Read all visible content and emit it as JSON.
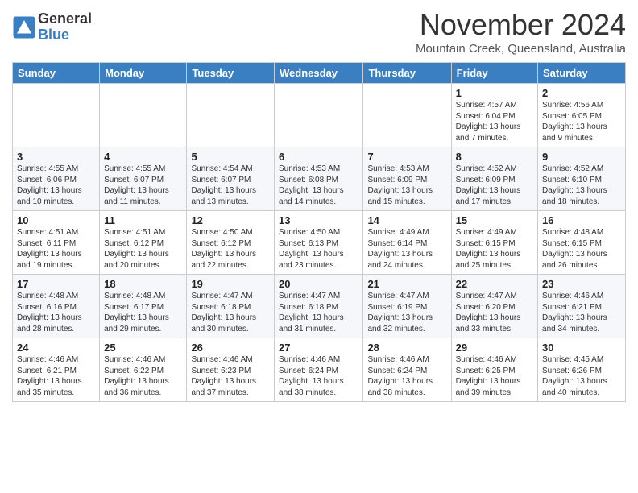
{
  "logo": {
    "general": "General",
    "blue": "Blue"
  },
  "header": {
    "month": "November 2024",
    "location": "Mountain Creek, Queensland, Australia"
  },
  "days_header": [
    "Sunday",
    "Monday",
    "Tuesday",
    "Wednesday",
    "Thursday",
    "Friday",
    "Saturday"
  ],
  "weeks": [
    [
      {
        "day": "",
        "info": ""
      },
      {
        "day": "",
        "info": ""
      },
      {
        "day": "",
        "info": ""
      },
      {
        "day": "",
        "info": ""
      },
      {
        "day": "",
        "info": ""
      },
      {
        "day": "1",
        "info": "Sunrise: 4:57 AM\nSunset: 6:04 PM\nDaylight: 13 hours and 7 minutes."
      },
      {
        "day": "2",
        "info": "Sunrise: 4:56 AM\nSunset: 6:05 PM\nDaylight: 13 hours and 9 minutes."
      }
    ],
    [
      {
        "day": "3",
        "info": "Sunrise: 4:55 AM\nSunset: 6:06 PM\nDaylight: 13 hours and 10 minutes."
      },
      {
        "day": "4",
        "info": "Sunrise: 4:55 AM\nSunset: 6:07 PM\nDaylight: 13 hours and 11 minutes."
      },
      {
        "day": "5",
        "info": "Sunrise: 4:54 AM\nSunset: 6:07 PM\nDaylight: 13 hours and 13 minutes."
      },
      {
        "day": "6",
        "info": "Sunrise: 4:53 AM\nSunset: 6:08 PM\nDaylight: 13 hours and 14 minutes."
      },
      {
        "day": "7",
        "info": "Sunrise: 4:53 AM\nSunset: 6:09 PM\nDaylight: 13 hours and 15 minutes."
      },
      {
        "day": "8",
        "info": "Sunrise: 4:52 AM\nSunset: 6:09 PM\nDaylight: 13 hours and 17 minutes."
      },
      {
        "day": "9",
        "info": "Sunrise: 4:52 AM\nSunset: 6:10 PM\nDaylight: 13 hours and 18 minutes."
      }
    ],
    [
      {
        "day": "10",
        "info": "Sunrise: 4:51 AM\nSunset: 6:11 PM\nDaylight: 13 hours and 19 minutes."
      },
      {
        "day": "11",
        "info": "Sunrise: 4:51 AM\nSunset: 6:12 PM\nDaylight: 13 hours and 20 minutes."
      },
      {
        "day": "12",
        "info": "Sunrise: 4:50 AM\nSunset: 6:12 PM\nDaylight: 13 hours and 22 minutes."
      },
      {
        "day": "13",
        "info": "Sunrise: 4:50 AM\nSunset: 6:13 PM\nDaylight: 13 hours and 23 minutes."
      },
      {
        "day": "14",
        "info": "Sunrise: 4:49 AM\nSunset: 6:14 PM\nDaylight: 13 hours and 24 minutes."
      },
      {
        "day": "15",
        "info": "Sunrise: 4:49 AM\nSunset: 6:15 PM\nDaylight: 13 hours and 25 minutes."
      },
      {
        "day": "16",
        "info": "Sunrise: 4:48 AM\nSunset: 6:15 PM\nDaylight: 13 hours and 26 minutes."
      }
    ],
    [
      {
        "day": "17",
        "info": "Sunrise: 4:48 AM\nSunset: 6:16 PM\nDaylight: 13 hours and 28 minutes."
      },
      {
        "day": "18",
        "info": "Sunrise: 4:48 AM\nSunset: 6:17 PM\nDaylight: 13 hours and 29 minutes."
      },
      {
        "day": "19",
        "info": "Sunrise: 4:47 AM\nSunset: 6:18 PM\nDaylight: 13 hours and 30 minutes."
      },
      {
        "day": "20",
        "info": "Sunrise: 4:47 AM\nSunset: 6:18 PM\nDaylight: 13 hours and 31 minutes."
      },
      {
        "day": "21",
        "info": "Sunrise: 4:47 AM\nSunset: 6:19 PM\nDaylight: 13 hours and 32 minutes."
      },
      {
        "day": "22",
        "info": "Sunrise: 4:47 AM\nSunset: 6:20 PM\nDaylight: 13 hours and 33 minutes."
      },
      {
        "day": "23",
        "info": "Sunrise: 4:46 AM\nSunset: 6:21 PM\nDaylight: 13 hours and 34 minutes."
      }
    ],
    [
      {
        "day": "24",
        "info": "Sunrise: 4:46 AM\nSunset: 6:21 PM\nDaylight: 13 hours and 35 minutes."
      },
      {
        "day": "25",
        "info": "Sunrise: 4:46 AM\nSunset: 6:22 PM\nDaylight: 13 hours and 36 minutes."
      },
      {
        "day": "26",
        "info": "Sunrise: 4:46 AM\nSunset: 6:23 PM\nDaylight: 13 hours and 37 minutes."
      },
      {
        "day": "27",
        "info": "Sunrise: 4:46 AM\nSunset: 6:24 PM\nDaylight: 13 hours and 38 minutes."
      },
      {
        "day": "28",
        "info": "Sunrise: 4:46 AM\nSunset: 6:24 PM\nDaylight: 13 hours and 38 minutes."
      },
      {
        "day": "29",
        "info": "Sunrise: 4:46 AM\nSunset: 6:25 PM\nDaylight: 13 hours and 39 minutes."
      },
      {
        "day": "30",
        "info": "Sunrise: 4:45 AM\nSunset: 6:26 PM\nDaylight: 13 hours and 40 minutes."
      }
    ]
  ]
}
